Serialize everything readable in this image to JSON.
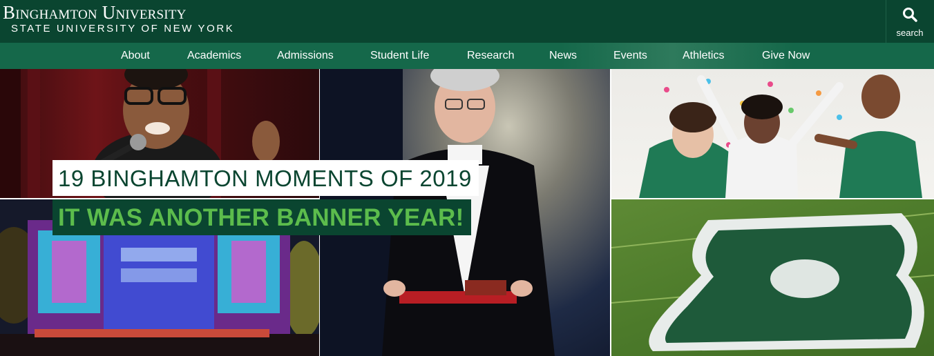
{
  "header": {
    "logo_main": "Binghamton University",
    "logo_sub": "STATE UNIVERSITY OF NEW YORK",
    "search_label": "search",
    "search_icon": "search-icon"
  },
  "nav": {
    "items": [
      {
        "label": "About"
      },
      {
        "label": "Academics"
      },
      {
        "label": "Admissions"
      },
      {
        "label": "Student Life"
      },
      {
        "label": "Research"
      },
      {
        "label": "News"
      },
      {
        "label": "Events"
      },
      {
        "label": "Athletics"
      },
      {
        "label": "Give Now"
      }
    ]
  },
  "hero": {
    "headline": "19 BINGHAMTON MOMENTS OF 2019",
    "subheadline": "IT WAS ANOTHER BANNER YEAR!"
  },
  "colors": {
    "brand_dark_green": "#0a4530",
    "nav_green": "#15684a",
    "accent_light_green": "#5cbc4c"
  }
}
